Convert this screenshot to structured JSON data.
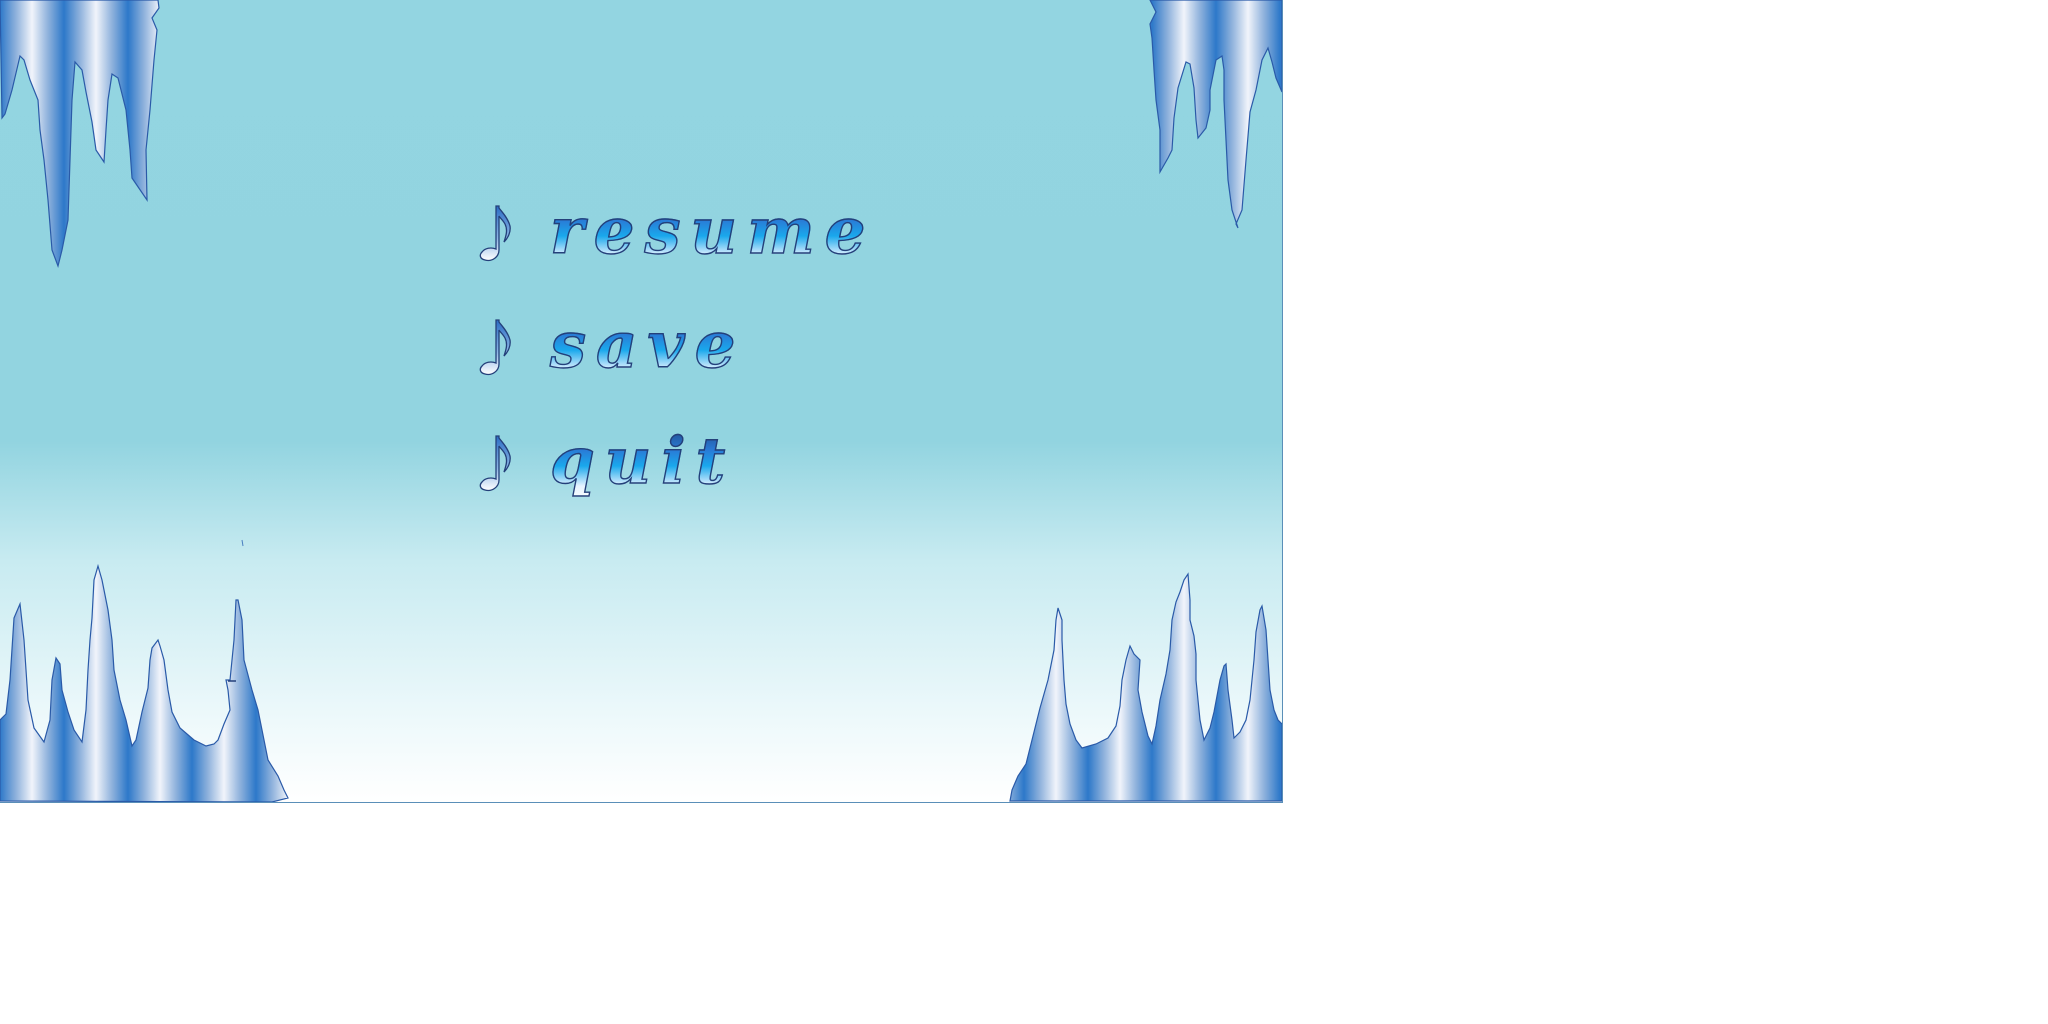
{
  "menu": {
    "items": [
      {
        "label": "resume",
        "icon": "music-note-icon"
      },
      {
        "label": "save",
        "icon": "music-note-icon"
      },
      {
        "label": "quit",
        "icon": "music-note-icon"
      }
    ]
  },
  "colors": {
    "background_top": "#93d5e1",
    "background_bottom": "#ffffff",
    "ice_dark": "#2c78c8",
    "ice_light": "#eef2fa",
    "text_outline": "#24407a"
  }
}
